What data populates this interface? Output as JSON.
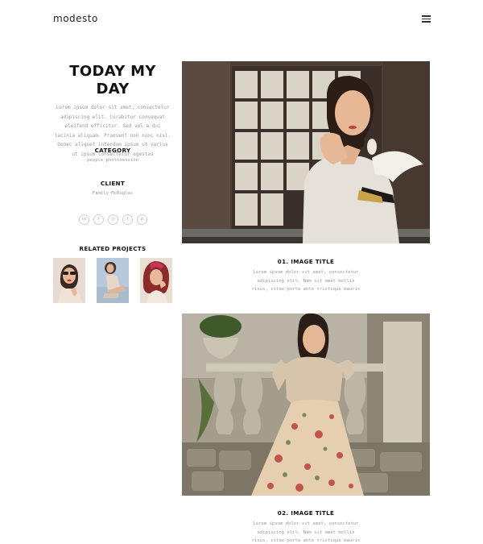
{
  "brand": {
    "logo_text": "modesto"
  },
  "nav": {
    "menu_icon": "hamburger-menu-icon"
  },
  "sidebar": {
    "title": "TODAY MY DAY",
    "intro": "Lorem ipsum dolor sit amet, consectetur adipiscing elit. Curabitur consequat eleifend efficitur. Sed vel a dui lacinia aliquam. Praesent non nunc nisl. Donec aliquet interdum ipsum ut varius ut ipsum consectetur egestas",
    "category_heading": "CATEGORY",
    "category_value": "people photosession",
    "client_heading": "CLIENT",
    "client_value": "Family McDuglas",
    "social": [
      {
        "icon": "linkedin-icon",
        "glyph": "in"
      },
      {
        "icon": "facebook-icon",
        "glyph": "f"
      },
      {
        "icon": "instagram-icon",
        "glyph": "◎"
      },
      {
        "icon": "twitter-icon",
        "glyph": "t"
      },
      {
        "icon": "pinterest-icon",
        "glyph": "p"
      }
    ],
    "related_heading": "RELATED PROJECTS"
  },
  "posts": [
    {
      "title": "01. IMAGE TITLE",
      "caption": "Lorem ipsum dolor sit amet, consectetur adipiscing elit. Nam sit amet mollis risus, vitae porta ante tristique mauris"
    },
    {
      "title": "02. IMAGE TITLE",
      "caption": "Lorem ipsum dolor sit amet, consectetur adipiscing elit. Nam sit amet mollis risus, vitae porta ante tristique mauris"
    }
  ]
}
